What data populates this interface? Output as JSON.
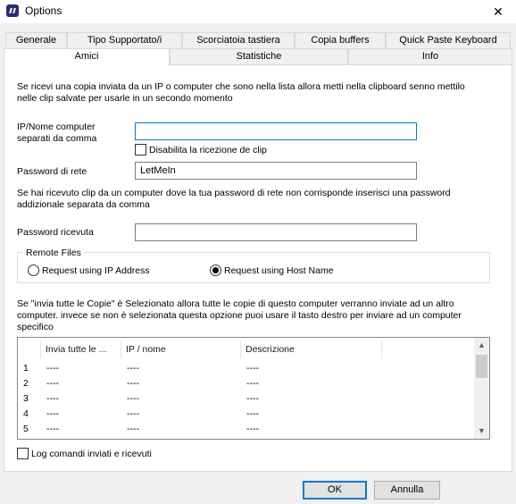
{
  "window": {
    "title": "Options"
  },
  "tabs_row1": [
    "Generale",
    "Tipo Supportato/i",
    "Scorciatoia tastiera",
    "Copia buffers",
    "Quick Paste Keyboard"
  ],
  "tabs_row2": [
    "Amici",
    "Statistiche",
    "Info"
  ],
  "intro_text": [
    "Se ricevi una copia inviata da un IP o computer che sono nella lista allora metti nella clipboard senno mettilo",
    "nelle clip salvate per usarle in un secondo momento"
  ],
  "ip_label": [
    "IP/Nome computer",
    "separati da comma"
  ],
  "ip_value": "",
  "disable_receive_label": "Disabilita la ricezione de clip",
  "password_label": "Password di rete",
  "password_value": "LetMeIn",
  "mismatch_text": [
    "Se hai ricevuto clip da un computer dove la tua password di rete non corrisponde inserisci una password",
    "addizionale separata da comma"
  ],
  "received_password_label": "Password ricevuta",
  "received_password_value": "",
  "remote_files": {
    "legend": "Remote Files",
    "option_ip": "Request using IP Address",
    "option_host": "Request using Host Name",
    "selected": "host"
  },
  "send_all_text": [
    "Se \"invia tutte le Copie\" è Selezionato allora tutte le copie di questo computer verranno inviate ad un altro",
    "computer. invece se non è selezionata questa opzione puoi usare il tasto destro per inviare ad un computer",
    "specifico"
  ],
  "table": {
    "columns": [
      "Invia tutte le ...",
      "IP / nome",
      "Descrizione"
    ],
    "rows": [
      {
        "num": "1",
        "cells": [
          "----",
          "----",
          "----"
        ]
      },
      {
        "num": "2",
        "cells": [
          "----",
          "----",
          "----"
        ]
      },
      {
        "num": "3",
        "cells": [
          "----",
          "----",
          "----"
        ]
      },
      {
        "num": "4",
        "cells": [
          "----",
          "----",
          "----"
        ]
      },
      {
        "num": "5",
        "cells": [
          "----",
          "----",
          "----"
        ]
      }
    ]
  },
  "log_label": "Log comandi inviati e ricevuti",
  "buttons": {
    "ok": "OK",
    "cancel": "Annulla"
  },
  "icons": {
    "close": "close-icon",
    "scroll_up": "scroll-up-icon",
    "scroll_down": "scroll-down-icon"
  }
}
